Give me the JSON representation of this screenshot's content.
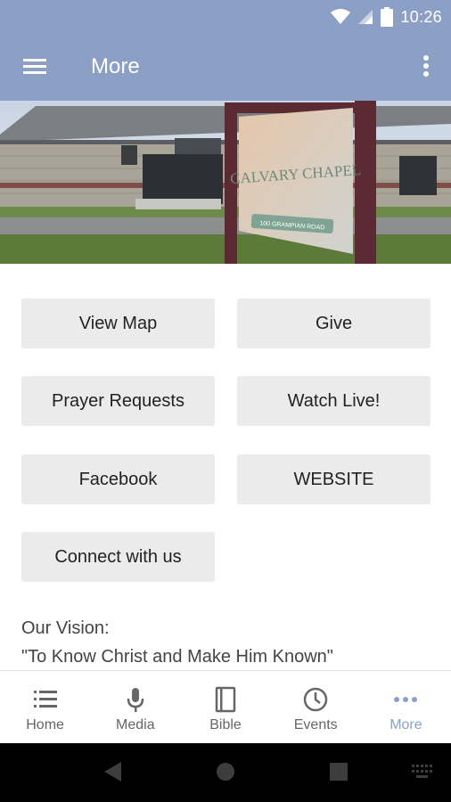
{
  "status_bar": {
    "time": "10:26"
  },
  "app_bar": {
    "title": "More"
  },
  "hero": {
    "sign_name": "CALVARY CHAPEL",
    "sign_address": "100 GRAMPIAN ROAD"
  },
  "buttons": {
    "view_map": "View Map",
    "give": "Give",
    "prayer_requests": "Prayer Requests",
    "watch_live": "Watch Live!",
    "facebook": "Facebook",
    "website": "WEBSITE",
    "connect": "Connect with us"
  },
  "vision": {
    "heading": "Our Vision:",
    "text": "\"To Know Christ and Make Him Known\""
  },
  "bottom_nav": {
    "items": [
      {
        "label": "Home",
        "icon": "list-icon"
      },
      {
        "label": "Media",
        "icon": "microphone-icon"
      },
      {
        "label": "Bible",
        "icon": "book-icon"
      },
      {
        "label": "Events",
        "icon": "clock-icon"
      },
      {
        "label": "More",
        "icon": "more-dots-icon"
      }
    ],
    "active": "More"
  },
  "colors": {
    "brand": "#8c9fc5",
    "button_bg": "#ebebeb",
    "inactive": "#666666"
  }
}
